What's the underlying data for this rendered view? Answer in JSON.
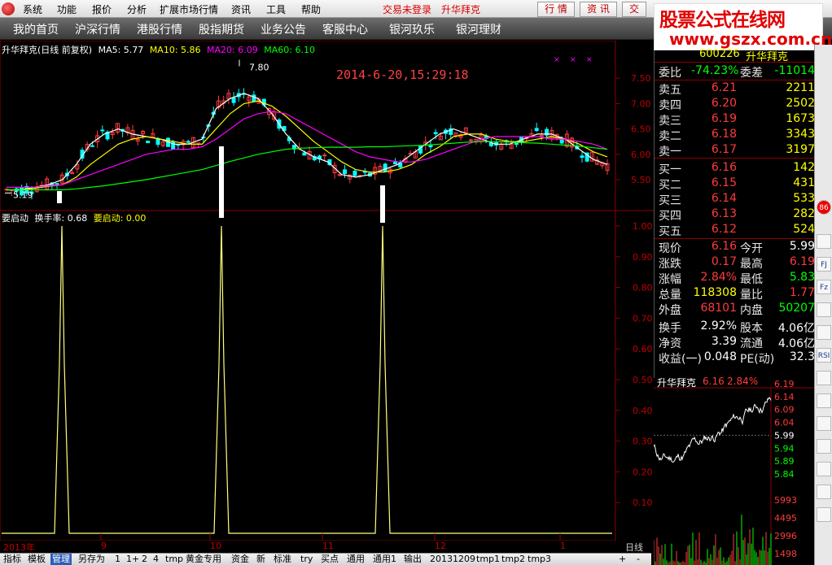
{
  "menubar": {
    "items": [
      "系统",
      "功能",
      "报价",
      "分析",
      "扩展市场行情",
      "资讯",
      "工具",
      "帮助"
    ],
    "login_status": "交易未登录",
    "stock_name": "升华拜克",
    "buttons": [
      "行 情",
      "资 讯",
      "交"
    ]
  },
  "brand": {
    "line1": "股票公式在线网",
    "line2": "www.gszx.com.cn"
  },
  "navbar": {
    "items": [
      "我的首页",
      "沪深行情",
      "港股行情",
      "股指期货",
      "业务公告",
      "客服中心",
      "银河玖乐",
      "银河理财"
    ]
  },
  "chart_info": {
    "title": "升华拜克(日线 前复权)",
    "ma5": "MA5: 5.77",
    "ma10": "MA10: 5.86",
    "ma20": "MA20: 6.09",
    "ma60": "MA60: 6.10",
    "datetime": "2014-6-20,15:29:18",
    "high_mark": "7.80",
    "low_mark": "5.19",
    "yaxis": [
      "7.50",
      "7.00",
      "6.50",
      "6.00",
      "5.50"
    ],
    "colors": {
      "ma5": "#ffffff",
      "ma10": "#ffff00",
      "ma20": "#ff00ff",
      "ma60": "#00ff00",
      "up": "#ff3b3b",
      "down": "#00ffff"
    }
  },
  "indicator": {
    "name": "要启动",
    "turnover": "换手率: 0.68",
    "value": "要启动: 0.00",
    "yaxis": [
      "1.00",
      "0.90",
      "0.80",
      "0.70",
      "0.60",
      "0.50",
      "0.40",
      "0.30",
      "0.20",
      "0.10"
    ]
  },
  "chart_data": [
    {
      "type": "line",
      "xlabel": "",
      "ylabel": "",
      "ylim": [
        5.1,
        8.0
      ],
      "series": [
        {
          "name": "MA5",
          "values": [
            5.3,
            5.3,
            5.35,
            5.4,
            5.5,
            5.8,
            6.2,
            6.4,
            6.5,
            6.4,
            6.35,
            6.3,
            6.2,
            6.2,
            6.3,
            6.9,
            7.1,
            7.2,
            7.1,
            6.8,
            6.4,
            6.1,
            5.95,
            5.85,
            5.6,
            5.55,
            5.6,
            5.7,
            5.8,
            6.0,
            6.2,
            6.4,
            6.5,
            6.4,
            6.3,
            6.2,
            6.2,
            6.3,
            6.4,
            6.4,
            6.3,
            6.1,
            5.9,
            5.8
          ]
        },
        {
          "name": "MA10",
          "values": [
            5.3,
            5.3,
            5.33,
            5.37,
            5.4,
            5.55,
            5.8,
            6.0,
            6.2,
            6.3,
            6.35,
            6.3,
            6.25,
            6.2,
            6.2,
            6.5,
            6.8,
            7.0,
            7.05,
            6.95,
            6.75,
            6.5,
            6.25,
            6.05,
            5.85,
            5.7,
            5.65,
            5.65,
            5.7,
            5.8,
            6.0,
            6.15,
            6.35,
            6.4,
            6.4,
            6.3,
            6.25,
            6.25,
            6.3,
            6.35,
            6.3,
            6.2,
            6.05,
            5.95
          ]
        },
        {
          "name": "MA20",
          "values": [
            5.35,
            5.35,
            5.35,
            5.38,
            5.4,
            5.5,
            5.6,
            5.7,
            5.8,
            5.9,
            6.0,
            6.05,
            6.1,
            6.1,
            6.15,
            6.3,
            6.5,
            6.7,
            6.8,
            6.85,
            6.8,
            6.65,
            6.5,
            6.35,
            6.2,
            6.05,
            5.95,
            5.9,
            5.85,
            5.85,
            5.9,
            6.0,
            6.1,
            6.2,
            6.3,
            6.35,
            6.35,
            6.35,
            6.35,
            6.3,
            6.3,
            6.25,
            6.2,
            6.1
          ]
        },
        {
          "name": "MA60",
          "values": [
            5.3,
            5.3,
            5.3,
            5.3,
            5.3,
            5.32,
            5.35,
            5.38,
            5.42,
            5.46,
            5.5,
            5.55,
            5.6,
            5.65,
            5.7,
            5.78,
            5.86,
            5.93,
            6.0,
            6.05,
            6.1,
            6.12,
            6.13,
            6.14,
            6.14,
            6.14,
            6.15,
            6.15,
            6.16,
            6.17,
            6.18,
            6.2,
            6.22,
            6.24,
            6.25,
            6.25,
            6.24,
            6.23,
            6.22,
            6.2,
            6.18,
            6.16,
            6.13,
            6.1
          ]
        }
      ]
    },
    {
      "type": "line",
      "ylim": [
        0,
        1
      ],
      "series": [
        {
          "name": "要启动",
          "values": [
            {
              "x": "2013-08",
              "y": 1
            },
            {
              "x": "2013-10",
              "y": 1
            },
            {
              "x": "2013-11",
              "y": 1
            }
          ]
        }
      ]
    }
  ],
  "timeaxis": {
    "labels": [
      "2013年",
      "9",
      "10",
      "11",
      "12",
      "1"
    ],
    "period": "日线"
  },
  "quote": {
    "code": "600226",
    "name": "升华拜克",
    "weibi": {
      "label": "委比",
      "value": "-74.23%",
      "label2": "委差",
      "value2": "-11014"
    },
    "sell": [
      {
        "label": "卖五",
        "price": "6.21",
        "vol": "2211"
      },
      {
        "label": "卖四",
        "price": "6.20",
        "vol": "2502"
      },
      {
        "label": "卖三",
        "price": "6.19",
        "vol": "1673"
      },
      {
        "label": "卖二",
        "price": "6.18",
        "vol": "3343"
      },
      {
        "label": "卖一",
        "price": "6.17",
        "vol": "3197"
      }
    ],
    "buy": [
      {
        "label": "买一",
        "price": "6.16",
        "vol": "142"
      },
      {
        "label": "买二",
        "price": "6.15",
        "vol": "431"
      },
      {
        "label": "买三",
        "price": "6.14",
        "vol": "533"
      },
      {
        "label": "买四",
        "price": "6.13",
        "vol": "282"
      },
      {
        "label": "买五",
        "price": "6.12",
        "vol": "524"
      }
    ],
    "stats": [
      {
        "l1": "现价",
        "v1": "6.16",
        "c1": "#ff3b3b",
        "l2": "今开",
        "v2": "5.99",
        "c2": "#ffffff"
      },
      {
        "l1": "涨跌",
        "v1": "0.17",
        "c1": "#ff3b3b",
        "l2": "最高",
        "v2": "6.19",
        "c2": "#ff3b3b"
      },
      {
        "l1": "涨幅",
        "v1": "2.84%",
        "c1": "#ff3b3b",
        "l2": "最低",
        "v2": "5.83",
        "c2": "#00ff00"
      },
      {
        "l1": "总量",
        "v1": "118308",
        "c1": "#ffff00",
        "l2": "量比",
        "v2": "1.77",
        "c2": "#ff3b3b"
      },
      {
        "l1": "外盘",
        "v1": "68101",
        "c1": "#ff3b3b",
        "l2": "内盘",
        "v2": "50207",
        "c2": "#00ff00"
      },
      {
        "l1": "换手",
        "v1": "2.92%",
        "c1": "#ffffff",
        "l2": "股本",
        "v2": "4.06亿",
        "c2": "#ffffff"
      },
      {
        "l1": "净资",
        "v1": "3.39",
        "c1": "#ffffff",
        "l2": "流通",
        "v2": "4.06亿",
        "c2": "#ffffff"
      },
      {
        "l1": "收益(一)",
        "v1": "0.048",
        "c1": "#ffffff",
        "l2": "PE(动)",
        "v2": "32.3",
        "c2": "#ffffff"
      }
    ]
  },
  "mini_chart": {
    "name": "升华拜克",
    "price": "6.16",
    "pct": "2.84%",
    "price_axis": [
      "6.19",
      "6.14",
      "6.09",
      "6.04",
      "5.99",
      "5.94",
      "5.89",
      "5.84"
    ],
    "vol_axis": [
      "5993",
      "4495",
      "2996",
      "1498"
    ]
  },
  "statusbar": {
    "tabs": [
      "指标",
      "模板",
      "管理",
      "另存为",
      "1",
      "1+",
      "2",
      "4",
      "tmp",
      "黄金专用",
      "资金",
      "新",
      "标准",
      "try",
      "买点",
      "通用",
      "通用1",
      "输出",
      "20131209",
      "tmp1",
      "tmp2",
      "tmp3"
    ],
    "active": "管理",
    "plus": "+",
    "minus": "-"
  },
  "toolbar": {
    "icons": [
      "86",
      "FJ",
      "Fz",
      "RSI"
    ]
  }
}
